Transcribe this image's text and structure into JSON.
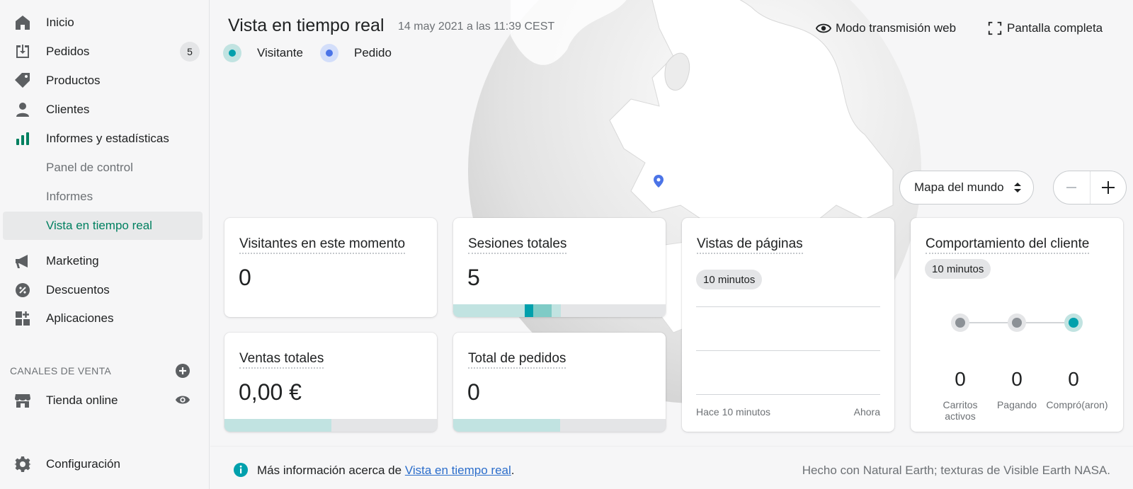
{
  "sidebar": {
    "items": [
      {
        "label": "Inicio"
      },
      {
        "label": "Pedidos",
        "badge": "5"
      },
      {
        "label": "Productos"
      },
      {
        "label": "Clientes"
      },
      {
        "label": "Informes y estadísticas"
      },
      {
        "label": "Panel de control"
      },
      {
        "label": "Informes"
      },
      {
        "label": "Vista en tiempo real"
      },
      {
        "label": "Marketing"
      },
      {
        "label": "Descuentos"
      },
      {
        "label": "Aplicaciones"
      }
    ],
    "sales_channels_title": "CANALES DE VENTA",
    "online_store": "Tienda online",
    "settings": "Configuración"
  },
  "header": {
    "title": "Vista en tiempo real",
    "date": "14 may 2021 a las 11:39 CEST",
    "legend": [
      {
        "label": "Visitante",
        "color": "#00a0ac"
      },
      {
        "label": "Pedido",
        "color": "#4b74e7"
      }
    ],
    "actions": {
      "broadcast": "Modo transmisión web",
      "fullscreen": "Pantalla completa"
    }
  },
  "map": {
    "select_value": "Mapa del mundo"
  },
  "cards": {
    "visitors": {
      "title": "Visitantes en este momento",
      "value": "0"
    },
    "sessions": {
      "title": "Sesiones totales",
      "value": "5"
    },
    "sales": {
      "title": "Ventas totales",
      "value": "0,00 €"
    },
    "orders": {
      "title": "Total de pedidos",
      "value": "0"
    },
    "pageviews": {
      "title": "Vistas de páginas",
      "period": "10 minutos",
      "x_start": "Hace 10 minutos",
      "x_end": "Ahora"
    },
    "behavior": {
      "title": "Comportamiento del cliente",
      "period": "10 minutos",
      "steps": [
        {
          "value": "0",
          "label_line1": "Carritos",
          "label_line2": "activos"
        },
        {
          "value": "0",
          "label_line1": "Pagando",
          "label_line2": ""
        },
        {
          "value": "0",
          "label_line1": "Compró(aron)",
          "label_line2": ""
        }
      ]
    }
  },
  "footer": {
    "info_prefix": "Más información acerca de ",
    "info_link": "Vista en tiempo real",
    "info_suffix": ".",
    "credit": "Hecho con Natural Earth; texturas de Visible Earth NASA."
  },
  "colors": {
    "accent_green": "#008060",
    "teal": "#00a0ac",
    "blue": "#4b74e7"
  }
}
